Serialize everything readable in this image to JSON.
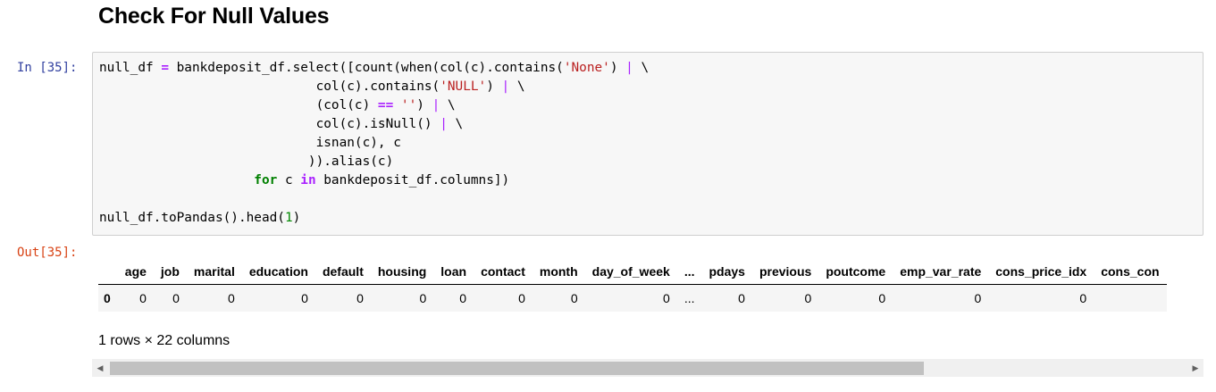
{
  "heading": "Check For Null Values",
  "input_prompt": "In [35]:",
  "output_prompt": "Out[35]:",
  "code": {
    "l1_a": "null_df ",
    "l1_op": "=",
    "l1_b": " bankdeposit_df.select([count(when(col(c).contains(",
    "l1_str": "'None'",
    "l1_c": ") ",
    "l1_pipe": "|",
    "l1_d": " \\",
    "l2_a": "                            col(c).contains(",
    "l2_str": "'NULL'",
    "l2_c": ") ",
    "l2_pipe": "|",
    "l2_d": " \\",
    "l3_a": "                            (col(c) ",
    "l3_op": "==",
    "l3_b": " ",
    "l3_str": "''",
    "l3_c": ") ",
    "l3_pipe": "|",
    "l3_d": " \\",
    "l4_a": "                            col(c).isNull() ",
    "l4_pipe": "|",
    "l4_d": " \\",
    "l5": "                            isnan(c), c",
    "l6": "                           )).alias(c)",
    "l7_indent": "                    ",
    "l7_for": "for",
    "l7_b": " c ",
    "l7_in": "in",
    "l7_c": " bankdeposit_df.columns])",
    "l8": "",
    "l9_a": "null_df.toPandas().head(",
    "l9_num": "1",
    "l9_b": ")"
  },
  "table": {
    "columns": [
      "",
      "age",
      "job",
      "marital",
      "education",
      "default",
      "housing",
      "loan",
      "contact",
      "month",
      "day_of_week",
      "...",
      "pdays",
      "previous",
      "poutcome",
      "emp_var_rate",
      "cons_price_idx",
      "cons_con"
    ],
    "rows": [
      [
        "0",
        "0",
        "0",
        "0",
        "0",
        "0",
        "0",
        "0",
        "0",
        "0",
        "0",
        "...",
        "0",
        "0",
        "0",
        "0",
        "0",
        ""
      ]
    ]
  },
  "rows_info": "1 rows × 22 columns",
  "scrollbar": {
    "left_arrow": "◀",
    "right_arrow": "▶",
    "position_fraction": 0.0,
    "visible_fraction": 0.74
  }
}
